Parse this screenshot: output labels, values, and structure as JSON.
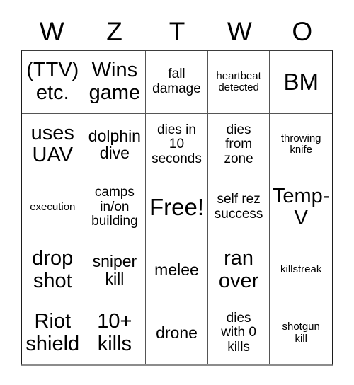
{
  "card": {
    "headers": [
      "W",
      "Z",
      "T",
      "W",
      "O"
    ],
    "cells": [
      {
        "text": "(TTV)\netc.",
        "size": "fs-lg"
      },
      {
        "text": "Wins\ngame",
        "size": "fs-lg"
      },
      {
        "text": "fall\ndamage",
        "size": "fs-sm"
      },
      {
        "text": "heartbeat\ndetected",
        "size": "fs-xs"
      },
      {
        "text": "BM",
        "size": "fs-xl"
      },
      {
        "text": "uses\nUAV",
        "size": "fs-lg"
      },
      {
        "text": "dolphin\ndive",
        "size": "fs-md"
      },
      {
        "text": "dies in\n10\nseconds",
        "size": "fs-sm"
      },
      {
        "text": "dies\nfrom\nzone",
        "size": "fs-sm"
      },
      {
        "text": "throwing\nknife",
        "size": "fs-xs"
      },
      {
        "text": "execution",
        "size": "fs-xs"
      },
      {
        "text": "camps\nin/on\nbuilding",
        "size": "fs-sm"
      },
      {
        "text": "Free!",
        "size": "fs-xl"
      },
      {
        "text": "self rez\nsuccess",
        "size": "fs-sm"
      },
      {
        "text": "Temp-\nV",
        "size": "fs-lg"
      },
      {
        "text": "drop\nshot",
        "size": "fs-lg"
      },
      {
        "text": "sniper\nkill",
        "size": "fs-md"
      },
      {
        "text": "melee",
        "size": "fs-md"
      },
      {
        "text": "ran\nover",
        "size": "fs-lg"
      },
      {
        "text": "killstreak",
        "size": "fs-xs"
      },
      {
        "text": "Riot\nshield",
        "size": "fs-lg"
      },
      {
        "text": "10+\nkills",
        "size": "fs-lg"
      },
      {
        "text": "drone",
        "size": "fs-md"
      },
      {
        "text": "dies\nwith 0\nkills",
        "size": "fs-sm"
      },
      {
        "text": "shotgun\nkill",
        "size": "fs-xs"
      }
    ]
  }
}
